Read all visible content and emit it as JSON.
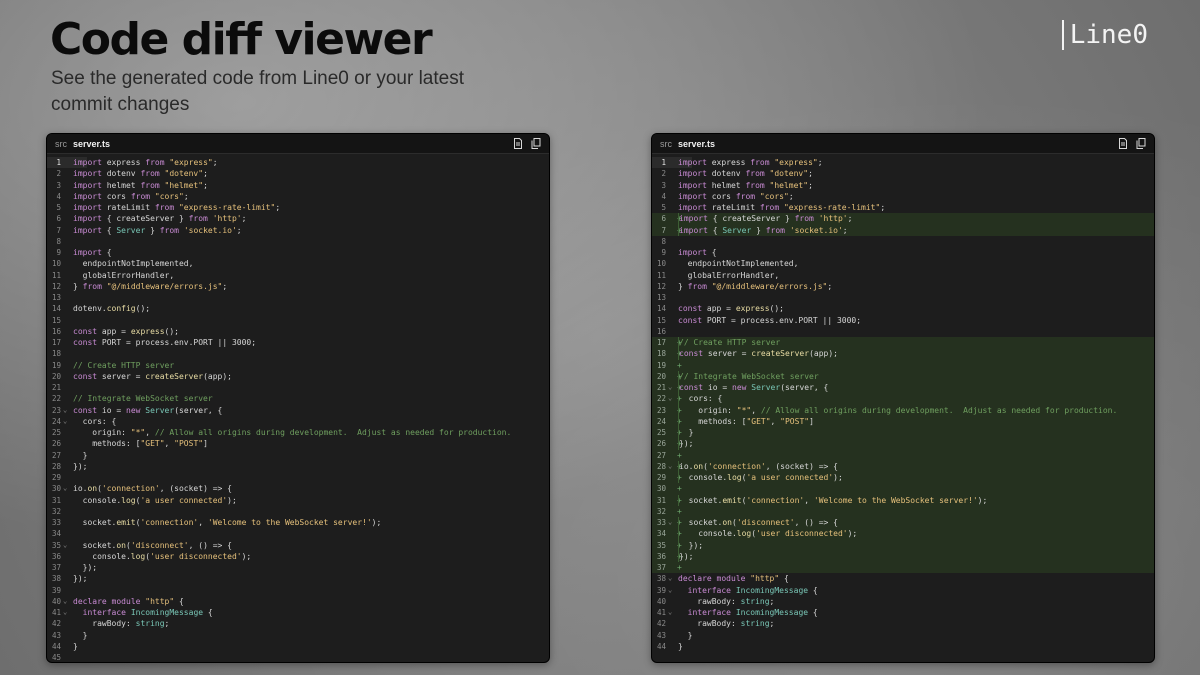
{
  "hero": {
    "title": "Code diff viewer",
    "subtitle": "See the generated code from Line0 or your latest commit changes"
  },
  "brand": {
    "logo_text": "Line0"
  },
  "colors": {
    "keyword": "#c98bd4",
    "string": "#e5c07b",
    "comment": "#6f9f5f",
    "added_bg": "#25311f",
    "panel_bg": "#1d1d1d"
  },
  "icons": {
    "file_icon": "file-icon",
    "copy_icon": "copy-icon"
  },
  "panels": [
    {
      "id": "left",
      "breadcrumb_dir": "src",
      "file_name": "server.ts",
      "active_line": 1,
      "lines": [
        {
          "n": 1,
          "t": "import express from \"express\";"
        },
        {
          "n": 2,
          "t": "import dotenv from \"dotenv\";"
        },
        {
          "n": 3,
          "t": "import helmet from \"helmet\";"
        },
        {
          "n": 4,
          "t": "import cors from \"cors\";"
        },
        {
          "n": 5,
          "t": "import rateLimit from \"express-rate-limit\";"
        },
        {
          "n": 6,
          "t": "import { createServer } from 'http';"
        },
        {
          "n": 7,
          "t": "import { Server } from 'socket.io';"
        },
        {
          "n": 8,
          "t": ""
        },
        {
          "n": 9,
          "t": "import {"
        },
        {
          "n": 10,
          "t": "  endpointNotImplemented,"
        },
        {
          "n": 11,
          "t": "  globalErrorHandler,"
        },
        {
          "n": 12,
          "t": "} from \"@/middleware/errors.js\";"
        },
        {
          "n": 13,
          "t": ""
        },
        {
          "n": 14,
          "t": "dotenv.config();"
        },
        {
          "n": 15,
          "t": ""
        },
        {
          "n": 16,
          "t": "const app = express();"
        },
        {
          "n": 17,
          "t": "const PORT = process.env.PORT || 3000;"
        },
        {
          "n": 18,
          "t": ""
        },
        {
          "n": 19,
          "t": "// Create HTTP server"
        },
        {
          "n": 20,
          "t": "const server = createServer(app);"
        },
        {
          "n": 21,
          "t": ""
        },
        {
          "n": 22,
          "t": "// Integrate WebSocket server"
        },
        {
          "n": 23,
          "t": "const io = new Server(server, {",
          "fold": true
        },
        {
          "n": 24,
          "t": "  cors: {",
          "fold": true
        },
        {
          "n": 25,
          "t": "    origin: \"*\", // Allow all origins during development.  Adjust as needed for production."
        },
        {
          "n": 26,
          "t": "    methods: [\"GET\", \"POST\"]"
        },
        {
          "n": 27,
          "t": "  }"
        },
        {
          "n": 28,
          "t": "});"
        },
        {
          "n": 29,
          "t": ""
        },
        {
          "n": 30,
          "t": "io.on('connection', (socket) => {",
          "fold": true
        },
        {
          "n": 31,
          "t": "  console.log('a user connected');"
        },
        {
          "n": 32,
          "t": ""
        },
        {
          "n": 33,
          "t": "  socket.emit('connection', 'Welcome to the WebSocket server!');"
        },
        {
          "n": 34,
          "t": ""
        },
        {
          "n": 35,
          "t": "  socket.on('disconnect', () => {",
          "fold": true
        },
        {
          "n": 36,
          "t": "    console.log('user disconnected');"
        },
        {
          "n": 37,
          "t": "  });"
        },
        {
          "n": 38,
          "t": "});"
        },
        {
          "n": 39,
          "t": ""
        },
        {
          "n": 40,
          "t": "declare module \"http\" {",
          "fold": true
        },
        {
          "n": 41,
          "t": "  interface IncomingMessage {",
          "fold": true
        },
        {
          "n": 42,
          "t": "    rawBody: string;"
        },
        {
          "n": 43,
          "t": "  }"
        },
        {
          "n": 44,
          "t": "}"
        },
        {
          "n": 45,
          "t": ""
        }
      ]
    },
    {
      "id": "right",
      "breadcrumb_dir": "src",
      "file_name": "server.ts",
      "active_line": 1,
      "lines": [
        {
          "n": 1,
          "t": "import express from \"express\";"
        },
        {
          "n": 2,
          "t": "import dotenv from \"dotenv\";"
        },
        {
          "n": 3,
          "t": "import helmet from \"helmet\";"
        },
        {
          "n": 4,
          "t": "import cors from \"cors\";"
        },
        {
          "n": 5,
          "t": "import rateLimit from \"express-rate-limit\";"
        },
        {
          "n": 6,
          "t": "import { createServer } from 'http';",
          "added": true
        },
        {
          "n": 7,
          "t": "import { Server } from 'socket.io';",
          "added": true
        },
        {
          "n": 8,
          "t": ""
        },
        {
          "n": 9,
          "t": "import {"
        },
        {
          "n": 10,
          "t": "  endpointNotImplemented,"
        },
        {
          "n": 11,
          "t": "  globalErrorHandler,"
        },
        {
          "n": 12,
          "t": "} from \"@/middleware/errors.js\";"
        },
        {
          "n": 13,
          "t": ""
        },
        {
          "n": 14,
          "t": "const app = express();"
        },
        {
          "n": 15,
          "t": "const PORT = process.env.PORT || 3000;"
        },
        {
          "n": 16,
          "t": ""
        },
        {
          "n": 17,
          "t": "// Create HTTP server",
          "added": true
        },
        {
          "n": 18,
          "t": "const server = createServer(app);",
          "added": true
        },
        {
          "n": 19,
          "t": "",
          "added": true
        },
        {
          "n": 20,
          "t": "// Integrate WebSocket server",
          "added": true
        },
        {
          "n": 21,
          "t": "const io = new Server(server, {",
          "added": true,
          "fold": true
        },
        {
          "n": 22,
          "t": "  cors: {",
          "added": true,
          "fold": true
        },
        {
          "n": 23,
          "t": "    origin: \"*\", // Allow all origins during development.  Adjust as needed for production.",
          "added": true
        },
        {
          "n": 24,
          "t": "    methods: [\"GET\", \"POST\"]",
          "added": true
        },
        {
          "n": 25,
          "t": "  }",
          "added": true
        },
        {
          "n": 26,
          "t": "});",
          "added": true
        },
        {
          "n": 27,
          "t": "",
          "added": true
        },
        {
          "n": 28,
          "t": "io.on('connection', (socket) => {",
          "added": true,
          "fold": true
        },
        {
          "n": 29,
          "t": "  console.log('a user connected');",
          "added": true
        },
        {
          "n": 30,
          "t": "",
          "added": true
        },
        {
          "n": 31,
          "t": "  socket.emit('connection', 'Welcome to the WebSocket server!');",
          "added": true
        },
        {
          "n": 32,
          "t": "",
          "added": true
        },
        {
          "n": 33,
          "t": "  socket.on('disconnect', () => {",
          "added": true,
          "fold": true
        },
        {
          "n": 34,
          "t": "    console.log('user disconnected');",
          "added": true
        },
        {
          "n": 35,
          "t": "  });",
          "added": true
        },
        {
          "n": 36,
          "t": "});",
          "added": true
        },
        {
          "n": 37,
          "t": "",
          "added": true
        },
        {
          "n": 38,
          "t": "declare module \"http\" {",
          "fold": true
        },
        {
          "n": 39,
          "t": "  interface IncomingMessage {",
          "fold": true
        },
        {
          "n": 40,
          "t": "    rawBody: string;"
        },
        {
          "n": 41,
          "t": "  interface IncomingMessage {",
          "fold": true
        },
        {
          "n": 42,
          "t": "    rawBody: string;"
        },
        {
          "n": 43,
          "t": "  }"
        },
        {
          "n": 44,
          "t": "}"
        }
      ]
    }
  ]
}
